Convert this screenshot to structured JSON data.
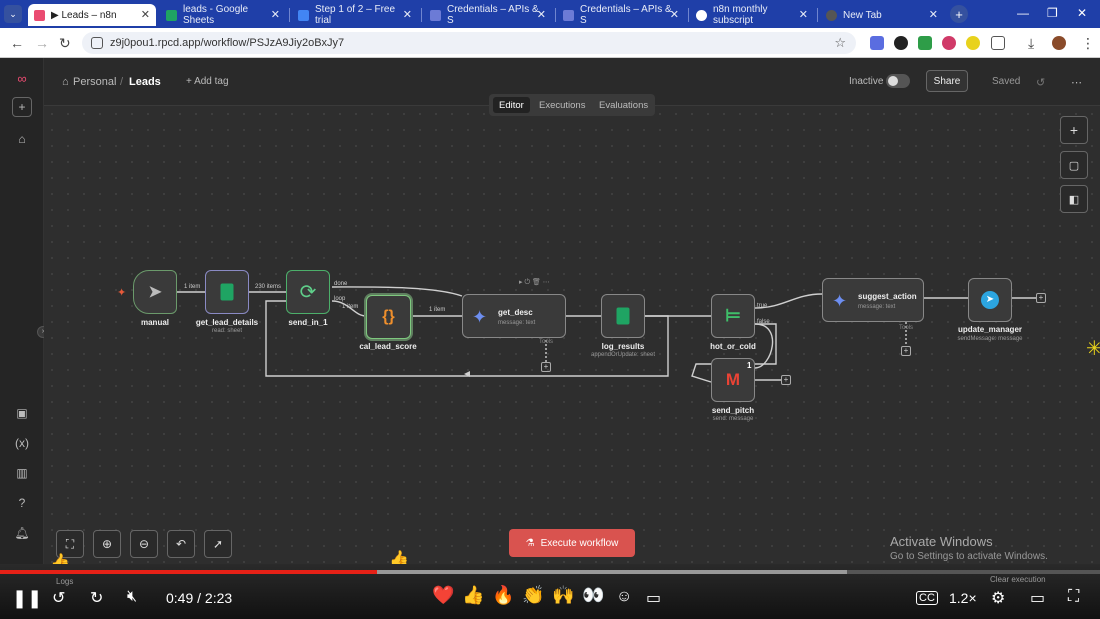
{
  "browser": {
    "tabs": [
      {
        "title": "▶ Leads – n8n",
        "active": true,
        "icon_color": "#ea4b71"
      },
      {
        "title": "leads - Google Sheets",
        "active": false,
        "icon_color": "#1fa463"
      },
      {
        "title": "Step 1 of 2 – Free trial",
        "active": false,
        "icon_color": "#4285f4"
      },
      {
        "title": "Credentials – APIs & S",
        "active": false,
        "icon_color": "#6c7bd6"
      },
      {
        "title": "Credentials – APIs & S",
        "active": false,
        "icon_color": "#6c7bd6"
      },
      {
        "title": "n8n monthly subscript",
        "active": false,
        "icon_color": "#ffffff"
      },
      {
        "title": "New Tab",
        "active": false,
        "icon_color": "#555555"
      }
    ],
    "url": "z9j0pou1.rpcd.app/workflow/PSJzA9Jiy2oBxJy7"
  },
  "app": {
    "breadcrumb_project": "Personal",
    "breadcrumb_workflow": "Leads",
    "add_tag": "+ Add tag",
    "status_label": "Inactive",
    "share_label": "Share",
    "saved_label": "Saved",
    "mode_tabs": [
      "Editor",
      "Executions",
      "Evaluations"
    ],
    "active_mode": "Editor",
    "execute_label": "Execute workflow"
  },
  "nodes": {
    "manual": {
      "label": "manual"
    },
    "get_lead_details": {
      "label": "get_lead_details",
      "sub": "read: sheet"
    },
    "send_in_1": {
      "label": "send_in_1"
    },
    "cal_lead_score": {
      "label": "cal_lead_score"
    },
    "get_desc": {
      "label": "get_desc",
      "sub": "message: text"
    },
    "log_results": {
      "label": "log_results",
      "sub": "appendOrUpdate: sheet"
    },
    "hot_or_cold": {
      "label": "hot_or_cold"
    },
    "send_pitch": {
      "label": "send_pitch",
      "sub": "send: message",
      "badge": "1"
    },
    "suggest_action": {
      "label": "suggest_action",
      "sub": "message: text"
    },
    "update_manager": {
      "label": "update_manager",
      "sub": "sendMessage: message"
    }
  },
  "edges": {
    "e1": "1 item",
    "e2": "230 items",
    "done": "done",
    "loop": "loop",
    "e3": "1 item",
    "e4": "1 item",
    "true": "true",
    "false": "false",
    "tools": "Tools"
  },
  "windows_notice": {
    "title": "Activate Windows",
    "subtitle": "Go to Settings to activate Windows."
  },
  "player": {
    "time": "0:49 / 2:23",
    "progress": 0.343,
    "buffered": 0.77,
    "speed": "1.2×",
    "logs_label": "Logs",
    "clear_label": "Clear execution",
    "reactions": [
      "❤️",
      "👍",
      "🔥",
      "👏",
      "🙌",
      "👀"
    ]
  }
}
